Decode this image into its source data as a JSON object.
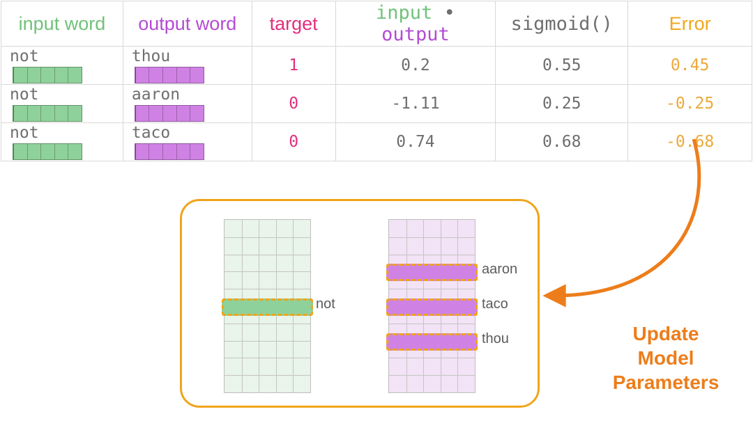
{
  "table": {
    "headers": {
      "input_word": "input word",
      "output_word": "output word",
      "target": "target",
      "dot": "input • output",
      "sigmoid": "sigmoid()",
      "error": "Error"
    },
    "rows": [
      {
        "input": "not",
        "output": "thou",
        "target": "1",
        "dot": "0.2",
        "sigmoid": "0.55",
        "error": "0.45"
      },
      {
        "input": "not",
        "output": "aaron",
        "target": "0",
        "dot": "-1.11",
        "sigmoid": "0.25",
        "error": "-0.25"
      },
      {
        "input": "not",
        "output": "taco",
        "target": "0",
        "dot": "0.74",
        "sigmoid": "0.68",
        "error": "-0.68"
      }
    ]
  },
  "panel": {
    "input_label": "not",
    "output_labels": {
      "top": "aaron",
      "mid": "taco",
      "bot": "thou"
    }
  },
  "caption": {
    "line1": "Update",
    "line2": "Model",
    "line3": "Parameters"
  },
  "colors": {
    "green": "#71c17a",
    "purple": "#b44bd4",
    "pink": "#e22f7e",
    "gray": "#6e6e6e",
    "orange": "#f0a71a",
    "accent": "#ed7d1a"
  }
}
